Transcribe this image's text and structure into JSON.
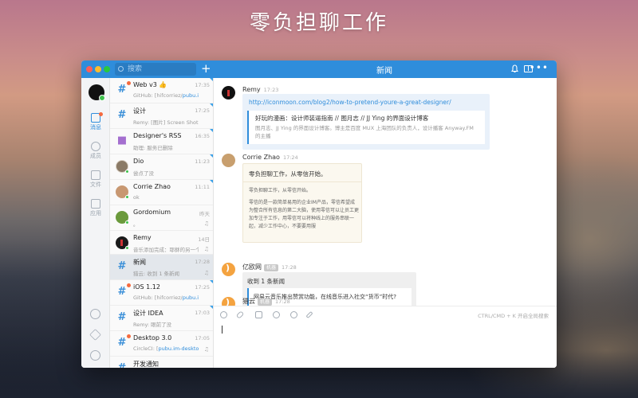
{
  "hero": {
    "title": "零负担聊工作"
  },
  "titlebar": {
    "search_placeholder": "搜索",
    "add_label": "+",
    "channel_title": "新闻",
    "more_label": "•••"
  },
  "rail": {
    "items": [
      {
        "label": "消息"
      },
      {
        "label": "成员"
      },
      {
        "label": "文件"
      },
      {
        "label": "应用"
      }
    ]
  },
  "conversations": [
    {
      "title": "Web v3 👍",
      "sub_prefix": "GitHub: [hifcorriez/",
      "sub_link": "pubu.im-hot...",
      "time": "17:35",
      "icon": "hash",
      "unread": true
    },
    {
      "title": "设计",
      "sub_prefix": "Remy: [图片] Screen Shot 2016...",
      "sub_link": "",
      "time": "17:25",
      "icon": "hash",
      "unread": false
    },
    {
      "title": "Designer's RSS",
      "sub_prefix": "助理: 服务已删除",
      "sub_link": "",
      "time": "16:35",
      "icon": "lock",
      "unread": false
    },
    {
      "title": "Dio",
      "sub_prefix": "尝点了没",
      "sub_link": "",
      "time": "11:23",
      "icon": "photo",
      "unread": false
    },
    {
      "title": "Corrie Zhao",
      "sub_prefix": "ok",
      "sub_link": "",
      "time": "11:11",
      "icon": "kid",
      "unread": false
    },
    {
      "title": "Gordomium",
      "sub_prefix": "。",
      "sub_link": "",
      "time": "昨天",
      "icon": "frog",
      "unread": false
    },
    {
      "title": "Remy",
      "sub_prefix": "音乐添加完成：耶稣的另一个名字",
      "sub_link": "",
      "time": "14日",
      "icon": "dark",
      "unread": false
    },
    {
      "title": "新闻",
      "sub_prefix": "猎云: 收到 1 条新闻",
      "sub_link": "",
      "time": "17:28",
      "icon": "hash",
      "unread": false,
      "selected": true
    },
    {
      "title": "iOS 1.12",
      "sub_prefix": "GitHub: [hifcorriez/",
      "sub_link": "pubu.im-ios...",
      "time": "17:25",
      "icon": "hash",
      "unread": true
    },
    {
      "title": "设计 IDEA",
      "sub_prefix": "Remy: 眼前了没",
      "sub_link": "",
      "time": "17:03",
      "icon": "hash",
      "unread": false
    },
    {
      "title": "Desktop 3.0",
      "sub_prefix": "CircleCI: [",
      "sub_link": "pubu.im-desktop...",
      "time": "17:05",
      "icon": "hash",
      "unread": true
    },
    {
      "title": "开发通知",
      "sub_prefix": "",
      "sub_link": "",
      "time": "",
      "icon": "hash",
      "unread": false
    }
  ],
  "messages": {
    "m1": {
      "author": "Remy",
      "time": "17:23",
      "url": "http://iconmoon.com/blog2/how-to-pretend-youre-a-great-designer/",
      "card_title": "好玩的漫画：设计师装逼指南 // 图月志 // JJ Ying 的界面设计博客",
      "card_desc": "图月志、JJ Ying 的界面设计博客。博主是百度 MUX 上海团队的负责人，设计播客 Anyway.FM 的主播"
    },
    "m2": {
      "author": "Corrie Zhao",
      "time": "17:24",
      "heading": "零负担聊工作，从零信开始。",
      "body1": "零负担聊工作，从零信开始。",
      "body2": "零信的是一款简单易用的企业IM产品，零信希望成为整合所有信息的第二大脑，使用零信可以让员工更加专注于工作，用零信可以将种线上的服务串联一起，减少工作中心，不要要用服"
    },
    "m3": {
      "author": "亿欧网",
      "bot": "机器",
      "time": "17:28",
      "heading": "收到 1 条新闻",
      "news": "网易云音乐推出赞赏功能，在线音乐进入社交“货币”时代?"
    },
    "m4": {
      "author": "猎云",
      "bot": "机器",
      "time": "17:28"
    }
  },
  "composer": {
    "hint": "CTRL/CMD + K 开启全局搜索"
  },
  "colors": {
    "accent": "#2f8ddb",
    "unread_dot": "#f56a3e",
    "online": "#3ec14c"
  }
}
